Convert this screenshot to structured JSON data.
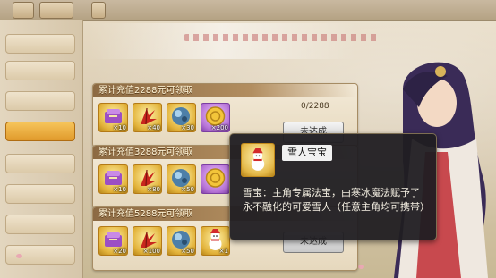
{
  "panels": [
    {
      "title": "累计充值2288元可领取",
      "progress": "0/2288",
      "button_label": "未达成",
      "rewards": [
        {
          "icon": "purple-scroll-icon",
          "qty": "×10",
          "frame": "gold"
        },
        {
          "icon": "red-feather-fan-icon",
          "qty": "×40",
          "frame": "gold"
        },
        {
          "icon": "blue-ore-icon",
          "qty": "×30",
          "frame": "gold"
        },
        {
          "icon": "gold-coin-icon",
          "qty": "×200",
          "frame": "purple"
        }
      ]
    },
    {
      "title": "累计充值3288元可领取",
      "progress": "",
      "button_label": "",
      "rewards": [
        {
          "icon": "purple-scroll-icon",
          "qty": "×10",
          "frame": "gold"
        },
        {
          "icon": "red-feather-fan-icon",
          "qty": "×80",
          "frame": "gold"
        },
        {
          "icon": "blue-ore-icon",
          "qty": "×50",
          "frame": "gold"
        },
        {
          "icon": "gold-coin-icon",
          "qty": "",
          "frame": "purple"
        }
      ]
    },
    {
      "title": "累计充值5288元可领取",
      "progress": "",
      "button_label": "未达成",
      "rewards": [
        {
          "icon": "purple-scroll-icon",
          "qty": "×20",
          "frame": "gold"
        },
        {
          "icon": "red-feather-fan-icon",
          "qty": "×100",
          "frame": "gold"
        },
        {
          "icon": "blue-ore-icon",
          "qty": "×50",
          "frame": "gold"
        },
        {
          "icon": "snowman-icon",
          "qty": "×1",
          "frame": "gold"
        }
      ]
    }
  ],
  "tooltip": {
    "title": "雪人宝宝",
    "description": "雪宝：主角专属法宝，由寒冰魔法赋予了永不融化的可爱雪人（任意主角均可携带）",
    "icon": "snowman-icon"
  }
}
